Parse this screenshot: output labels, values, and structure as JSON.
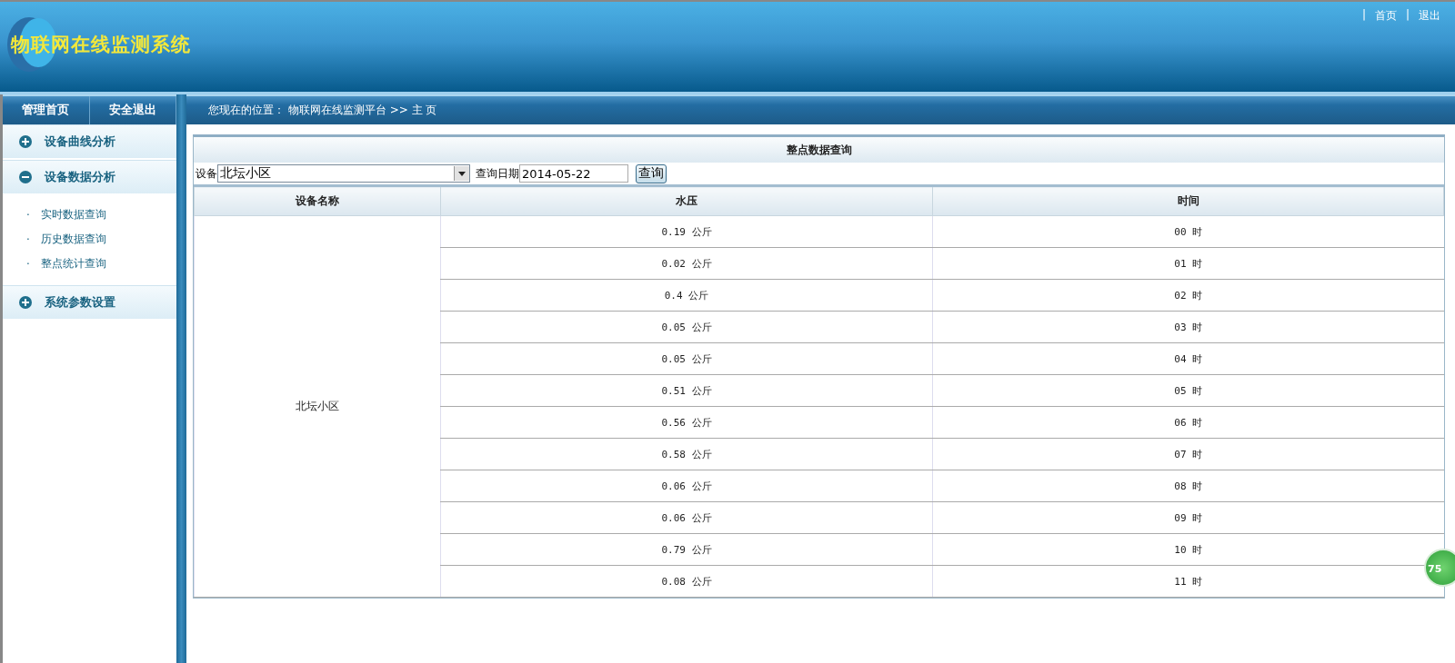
{
  "header": {
    "logo_text": "物联网在线监测系统",
    "links": [
      {
        "separator": "|",
        "label": "首页"
      },
      {
        "separator": "|",
        "label": "退出"
      }
    ]
  },
  "nav": {
    "buttons": [
      "管理首页",
      "安全退出"
    ],
    "breadcrumb": "您现在的位置： 物联网在线监测平台 >> 主 页"
  },
  "sidebar": {
    "groups": [
      {
        "label": "设备曲线分析",
        "expanded": false
      },
      {
        "label": "设备数据分析",
        "expanded": true,
        "children": [
          {
            "bullet": "·",
            "label": "实时数据查询"
          },
          {
            "bullet": "·",
            "label": "历史数据查询"
          },
          {
            "bullet": "·",
            "label": "整点统计查询"
          }
        ]
      },
      {
        "label": "系统参数设置",
        "expanded": false
      }
    ]
  },
  "panel": {
    "title": "整点数据查询",
    "device_label": "设备",
    "device_value": "北坛小区",
    "date_label": "查询日期",
    "date_value": "2014-05-22",
    "query_button": "查询"
  },
  "table": {
    "columns": [
      "设备名称",
      "水压",
      "时间"
    ],
    "device": "北坛小区",
    "rows": [
      {
        "pressure": "0.19 公斤",
        "time": "00 时"
      },
      {
        "pressure": "0.02 公斤",
        "time": "01 时"
      },
      {
        "pressure": "0.4 公斤",
        "time": "02 时"
      },
      {
        "pressure": "0.05 公斤",
        "time": "03 时"
      },
      {
        "pressure": "0.05 公斤",
        "time": "04 时"
      },
      {
        "pressure": "0.51 公斤",
        "time": "05 时"
      },
      {
        "pressure": "0.56 公斤",
        "time": "06 时"
      },
      {
        "pressure": "0.58 公斤",
        "time": "07 时"
      },
      {
        "pressure": "0.06 公斤",
        "time": "08 时"
      },
      {
        "pressure": "0.06 公斤",
        "time": "09 时"
      },
      {
        "pressure": "0.79 公斤",
        "time": "10 时"
      },
      {
        "pressure": "0.08 公斤",
        "time": "11 时"
      }
    ]
  },
  "floating_badge": "75"
}
